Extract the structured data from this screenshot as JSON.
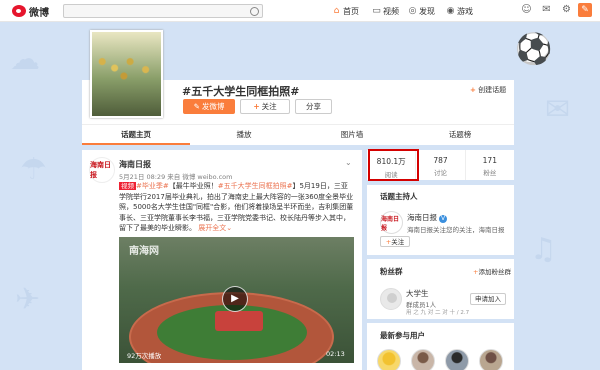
{
  "topbar": {
    "logo_text": "微博",
    "search_placeholder": "",
    "nav": [
      {
        "label": "首页",
        "icon": "home-icon"
      },
      {
        "label": "视频",
        "icon": "video-icon"
      },
      {
        "label": "发现",
        "icon": "discover-icon"
      },
      {
        "label": "游戏",
        "icon": "game-icon"
      }
    ]
  },
  "topic": {
    "title": "#五千大学生同框拍照#",
    "post_button": "发微博",
    "follow_button": "关注",
    "share_button": "分享",
    "create_link": "创建话题"
  },
  "tabs": [
    "话题主页",
    "播放",
    "图片墙",
    "话题榜"
  ],
  "post": {
    "avatar_text": "海南日报",
    "author": "海南日报",
    "meta": "5月21日 08:29 来自 微博 weibo.com",
    "badge": "视频",
    "text_before": "",
    "hashtag1": "#毕业季#",
    "text_mid1": "【最牛毕业照！",
    "hashtag2": "#五千大学生同框拍照#",
    "text_rest": "】5月19日，三亚学院举行2017届毕业典礼，拍出了海南史上最大阵容的一张360度全景毕业照，5000名大学生佳国\"同框\"合影，他们将着操场呈半环而坐，吉利集团董事长、三亚学院董事长李书福，三亚学院党委书记、校长陆丹等步入其中，留下了最美的毕业瞬影。",
    "expand": "展开全文",
    "video": {
      "watermark": "南海网",
      "views": "92万次播放",
      "duration": "02:13"
    }
  },
  "stats": [
    {
      "num": "810.1万",
      "label": "阅读"
    },
    {
      "num": "787",
      "label": "讨论"
    },
    {
      "num": "171",
      "label": "粉丝"
    }
  ],
  "host": {
    "section_title": "话题主持人",
    "avatar_text": "海南日报",
    "name": "海南日报",
    "verify": "V",
    "desc": "海南日报关注您的关注，海南日报",
    "follow": "关注"
  },
  "fans": {
    "section_title": "粉丝群",
    "add_link": "添加粉丝群",
    "name": "大学生",
    "role": "群成员1人",
    "sub": "用 之 九 对 二 对 十 / 2.7",
    "apply": "申请加入"
  },
  "recent": {
    "section_title": "最新参与用户"
  }
}
